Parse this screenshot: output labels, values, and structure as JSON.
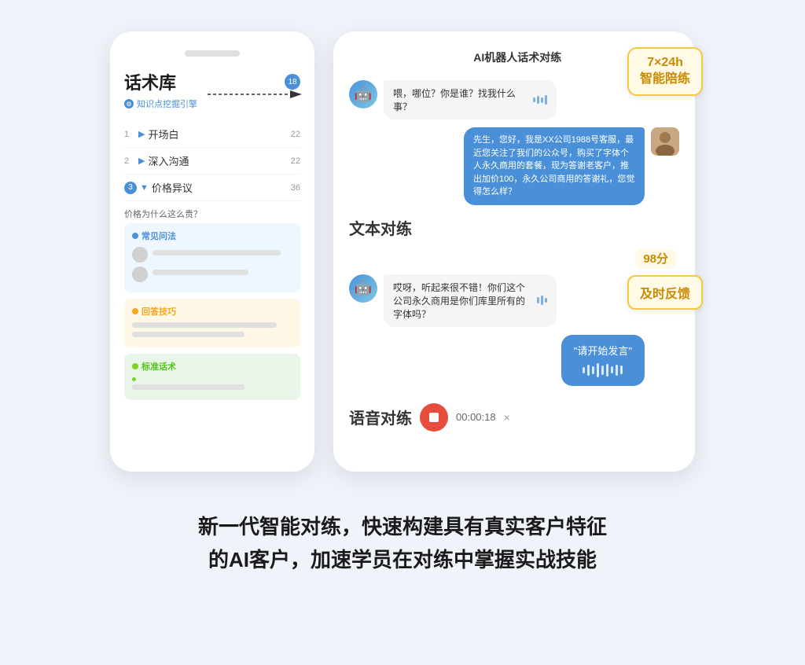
{
  "page": {
    "background": "#f0f4fa"
  },
  "phone": {
    "title": "话术库",
    "subtitle": "知识点挖掘引擎",
    "badge_count": "18",
    "list_items": [
      {
        "num": "1",
        "arrow": "▶",
        "label": "开场白",
        "count": "22"
      },
      {
        "num": "2",
        "arrow": "▶",
        "label": "深入沟通",
        "count": "22"
      },
      {
        "num": "3",
        "arrow": "▼",
        "label": "价格异议",
        "count": "36"
      }
    ],
    "question": "价格为什么这么贵？",
    "faq_label": "常见问法",
    "tip_label": "回答技巧",
    "std_label": "标准话术"
  },
  "chat": {
    "header_title": "AI机器人话术对练",
    "badge_7x24": "7×24h\n智能陪练",
    "badge_timely": "及时反馈",
    "score": "98分",
    "msg1_bot": "喂，哪位？你是谁？找我什么事？",
    "msg2_human": "先生，您好，我是XX公司1988号客服，最近您关注了我们的公众号，购买了字体个人永久商用的套餐，现为答谢老客户，推出加价100，永久公司商用的答谢礼，您觉得怎么样？",
    "text_practice_label": "文本对练",
    "msg3_bot": "哎呀，听起来很不错！你们这个公司永久商用是你们库里所有的字体吗？",
    "voice_bubble_text": "\"请开始发言\"",
    "voice_label": "语音对练",
    "timer": "00:00:18",
    "close": "×"
  },
  "bottom": {
    "line1": "新一代智能对练，快速构建具有真实客户特征",
    "line2": "的AI客户，加速学员在对练中掌握实战技能"
  }
}
